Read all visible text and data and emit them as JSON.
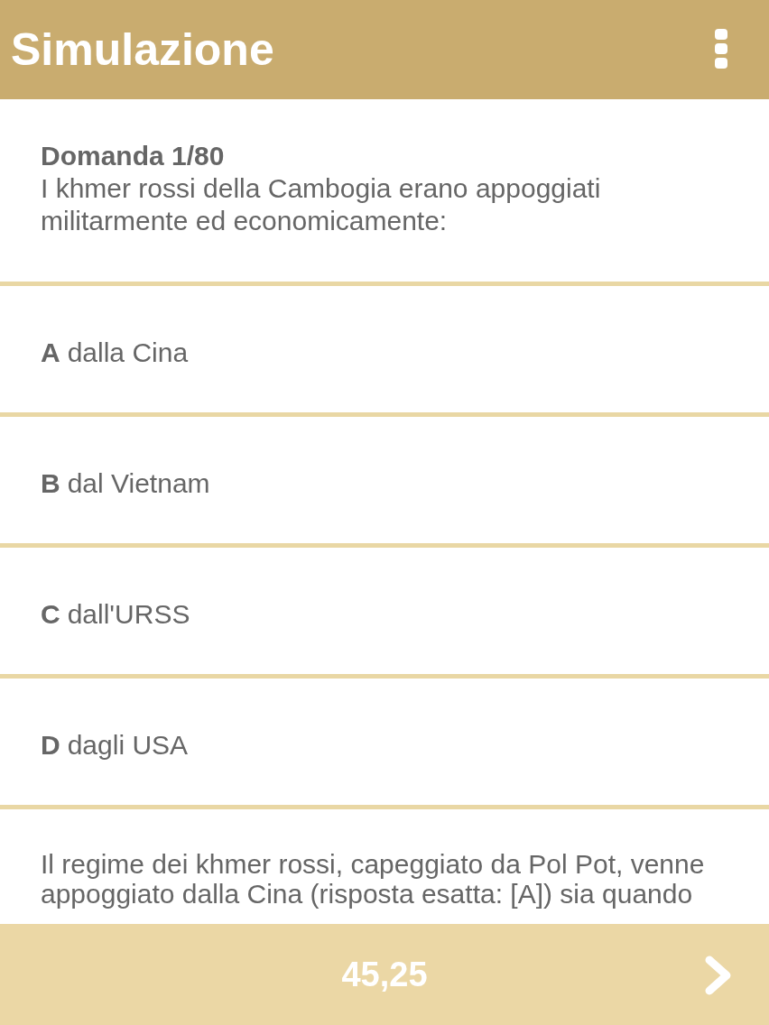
{
  "app_bar": {
    "title": "Simulazione"
  },
  "question": {
    "number": "Domanda 1/80",
    "text": "I khmer rossi della Cambogia erano appoggiati militarmente ed economicamente:"
  },
  "answers": [
    {
      "letter": "A",
      "text": "dalla Cina"
    },
    {
      "letter": "B",
      "text": "dal Vietnam"
    },
    {
      "letter": "C",
      "text": "dall'URSS"
    },
    {
      "letter": "D",
      "text": "dagli USA"
    }
  ],
  "explanation": {
    "text": "Il regime dei khmer rossi, capeggiato da Pol Pot, venne appoggiato dalla Cina (risposta esatta: [A]) sia quando"
  },
  "bottom_bar": {
    "score": "45,25"
  }
}
